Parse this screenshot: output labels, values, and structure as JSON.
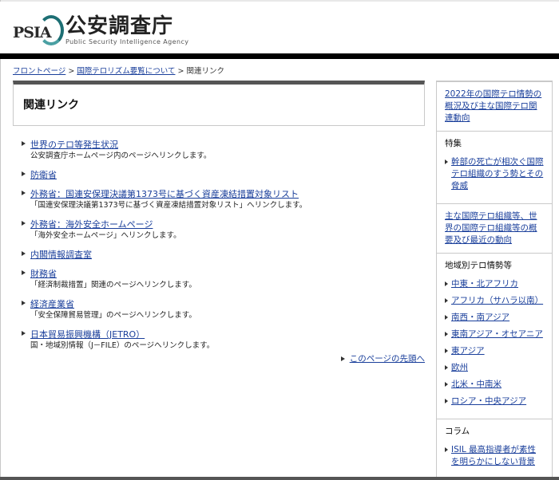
{
  "header": {
    "logo_abbr": "PSIA",
    "logo_name": "公安調査庁",
    "logo_english": "Public Security Intelligence Agency"
  },
  "breadcrumb": {
    "items": [
      "フロントページ",
      "国際テロリズム要覧について"
    ],
    "separator": ">",
    "current": "関連リンク"
  },
  "main": {
    "title": "関連リンク",
    "links": [
      {
        "label": "世界のテロ等発生状況",
        "desc": "公安調査庁ホームページ内のページへリンクします。"
      },
      {
        "label": "防衛省",
        "desc": ""
      },
      {
        "label": "外務省：国連安保理決議第1373号に基づく資産凍結措置対象リスト",
        "desc": "「国連安保理決議第1373号に基づく資産凍結措置対象リスト」へリンクします。"
      },
      {
        "label": "外務省：海外安全ホームページ",
        "desc": "「海外安全ホームページ」へリンクします。"
      },
      {
        "label": "内閣情報調査室",
        "desc": ""
      },
      {
        "label": "財務省",
        "desc": "「経済制裁措置」関連のページへリンクします。"
      },
      {
        "label": "経済産業省",
        "desc": "「安全保障貿易管理」のページへリンクします。"
      },
      {
        "label": "日本貿易振興機構（JETRO）",
        "desc": "国・地域別情報（J－FILE）のページへリンクします。"
      }
    ],
    "page_top": "このページの先頭へ"
  },
  "sidebar": {
    "trend_link": "2022年の国際テロ情勢の概況及び主な国際テロ関連動向",
    "feature_heading": "特集",
    "feature_links": [
      "幹部の死亡が相次ぐ国際テロ組織のすう勢とその脅威"
    ],
    "orgs_link": "主な国際テロ組織等、世界の国際テロ組織等の概要及び最近の動向",
    "region_heading": "地域別テロ情勢等",
    "regions": [
      "中東・北アフリカ",
      "アフリカ（サハラ以南）",
      "南西・南アジア",
      "東南アジア・オセアニア",
      "東アジア",
      "欧州",
      "北米・中南米",
      "ロシア・中央アジア"
    ],
    "column_heading": "コラム",
    "column_links": [
      "ISIL 最高指導者が素性を明らかにしない背景"
    ]
  },
  "colors": {
    "link": "#1a3f9b",
    "header_bar": "#000000",
    "title_border": "#555555",
    "logo_accent": "#1d6f74"
  }
}
